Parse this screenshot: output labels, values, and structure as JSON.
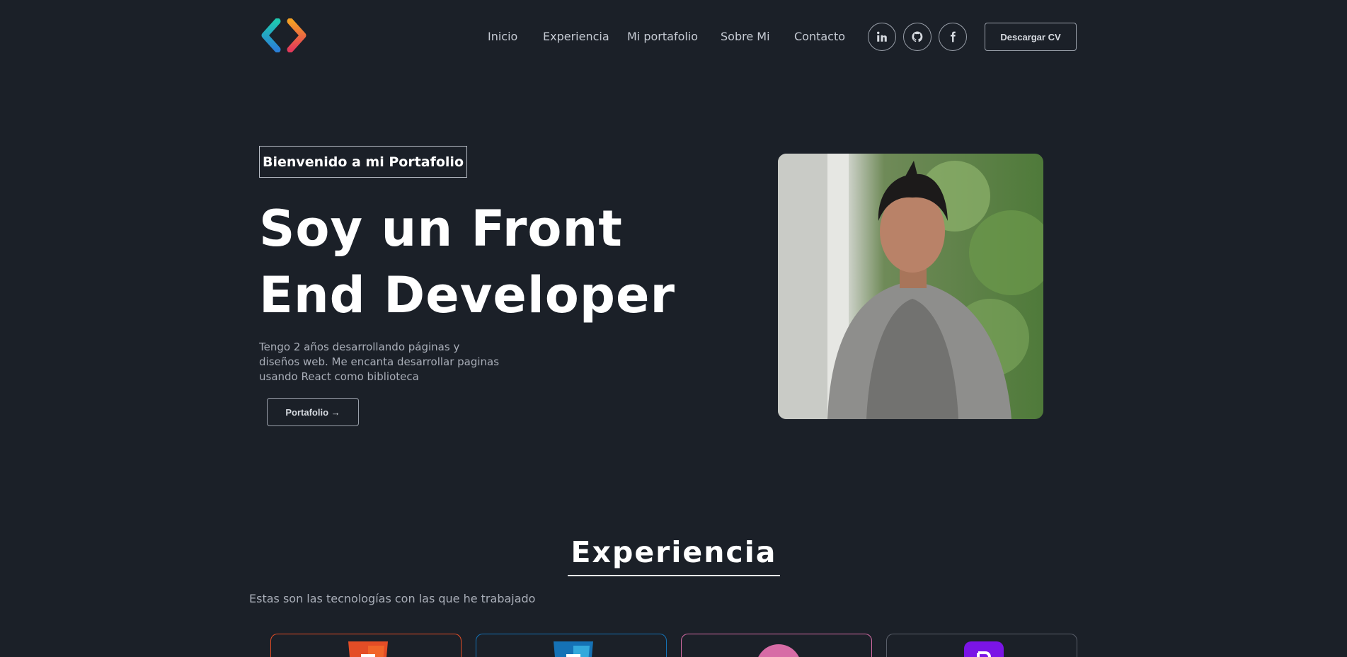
{
  "header": {
    "logo": "code-brackets-logo",
    "nav": [
      {
        "label": "Inicio"
      },
      {
        "label": "Experiencia"
      },
      {
        "label": "Mi portafolio"
      },
      {
        "label": "Sobre Mi"
      },
      {
        "label": "Contacto"
      }
    ],
    "social": [
      {
        "icon": "linkedin-icon"
      },
      {
        "icon": "github-icon"
      },
      {
        "icon": "facebook-icon"
      }
    ],
    "cv_label": "Descargar CV"
  },
  "hero": {
    "badge": "Bienvenido a mi Portafolio",
    "title": "Soy un Front End Developer",
    "description": "Tengo 2 años desarrollando páginas y diseños web. Me encanta desarrollar paginas usando React como biblioteca",
    "button_label": "Portafolio →",
    "photo": "profile-photo"
  },
  "experience": {
    "title": "Experiencia",
    "subtitle": "Estas son las tecnologías con las que he trabajado",
    "cards": [
      {
        "icon": "html5-icon",
        "color": "#e44d26"
      },
      {
        "icon": "css3-icon",
        "color": "#1572b6"
      },
      {
        "icon": "redux-saga-icon",
        "color": "#d76ca6"
      },
      {
        "icon": "bootstrap-icon",
        "color": "#7952b3"
      }
    ]
  },
  "colors": {
    "background": "#1b2028",
    "text": "#ffffff",
    "muted": "#a9aeb8",
    "border": "#9aa0aa"
  }
}
